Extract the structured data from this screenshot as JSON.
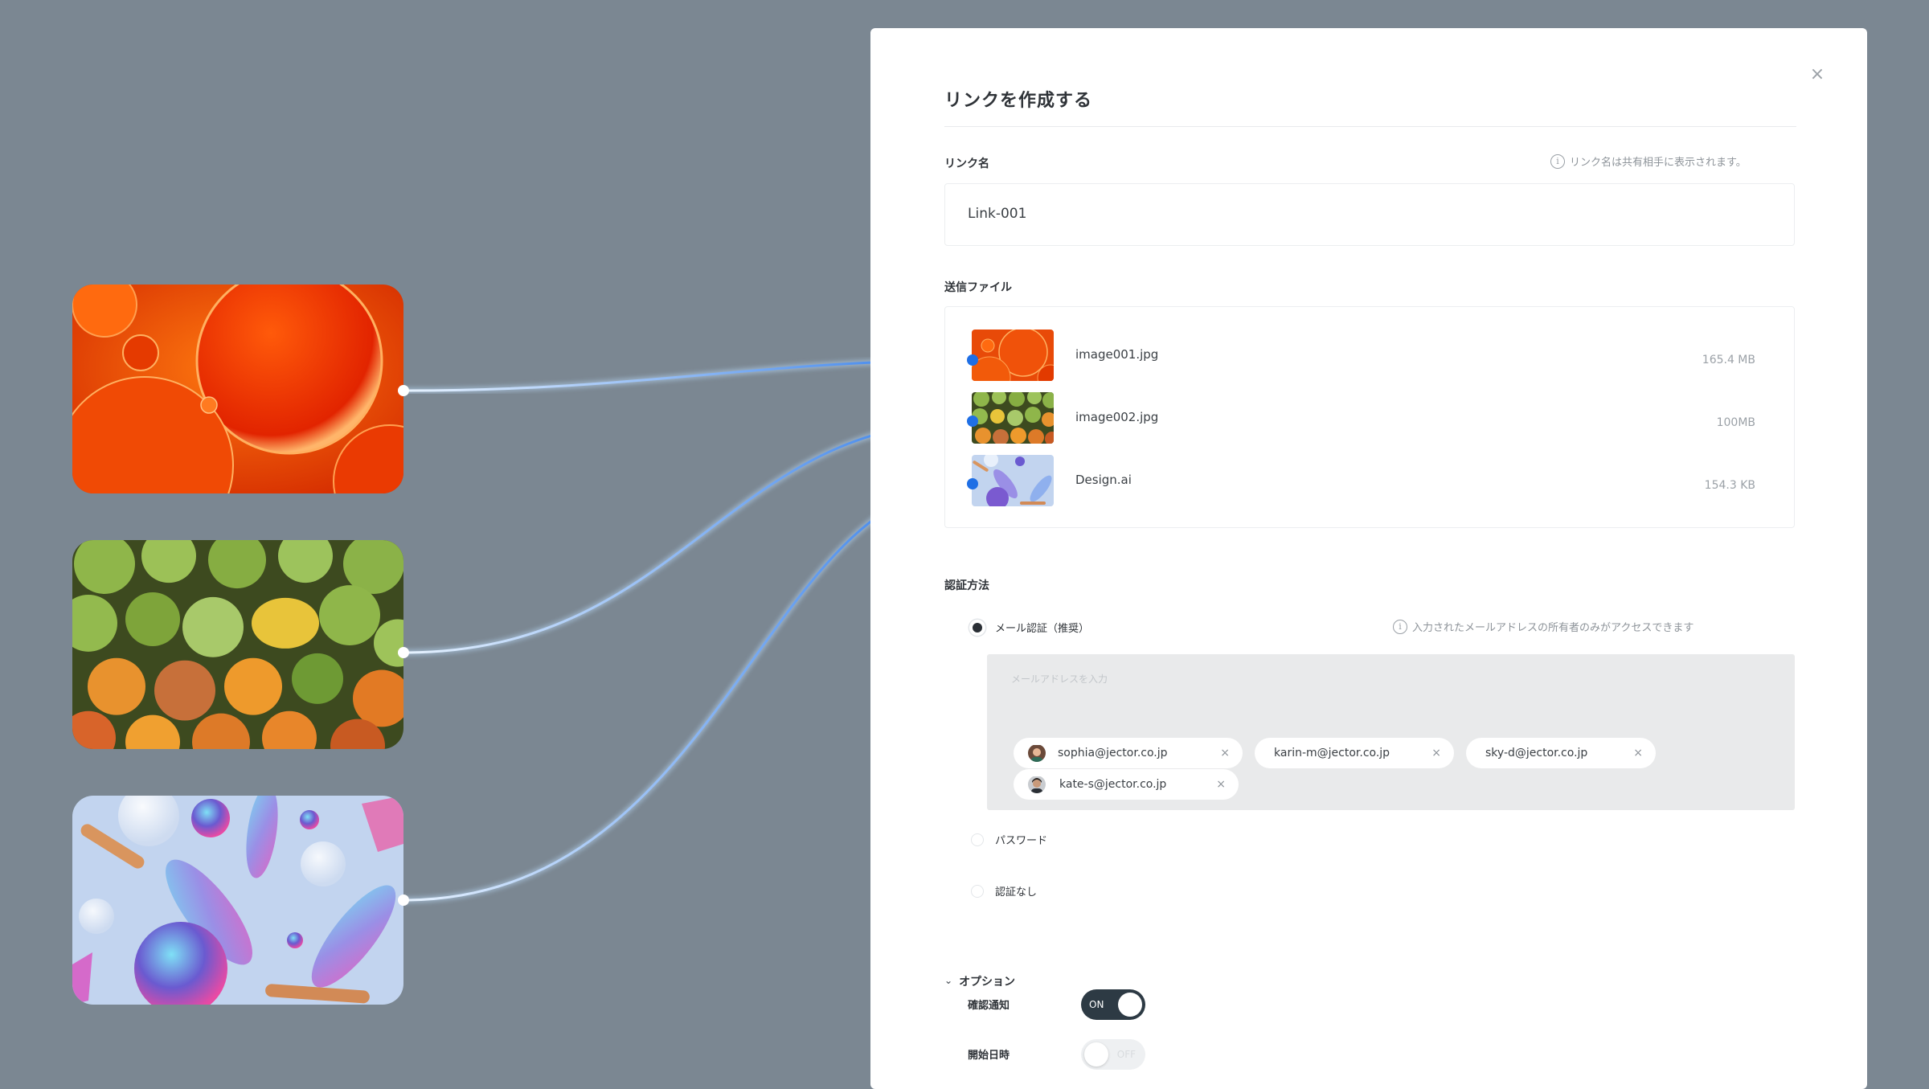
{
  "dialog": {
    "title": "リンクを作成する",
    "close_icon": "×"
  },
  "link_name": {
    "label": "リンク名",
    "hint": "リンク名は共有相手に表示されます。",
    "value": "Link-001"
  },
  "files": {
    "label": "送信ファイル",
    "items": [
      {
        "name": "image001.jpg",
        "size": "165.4 MB"
      },
      {
        "name": "image002.jpg",
        "size": "100MB"
      },
      {
        "name": "Design.ai",
        "size": "154.3 KB"
      }
    ]
  },
  "auth": {
    "label": "認証方法",
    "options": [
      {
        "label": "メール認証（推奨）",
        "selected": true
      },
      {
        "label": "パスワード",
        "selected": false
      },
      {
        "label": "認証なし",
        "selected": false
      }
    ],
    "email_hint": "入力されたメールアドレスの所有者のみがアクセスできます",
    "email_placeholder": "メールアドレスを入力",
    "emails": [
      {
        "address": "sophia@jector.co.jp",
        "has_avatar": true
      },
      {
        "address": "karin-m@jector.co.jp",
        "has_avatar": false
      },
      {
        "address": "sky-d@jector.co.jp",
        "has_avatar": false
      },
      {
        "address": "kate-s@jector.co.jp",
        "has_avatar": true
      }
    ],
    "chip_remove": "×"
  },
  "options": {
    "label": "オプション",
    "items": [
      {
        "label": "確認通知",
        "state": "ON",
        "on": true
      },
      {
        "label": "開始日時",
        "state": "OFF",
        "on": false
      }
    ]
  },
  "colors": {
    "background": "#7b8792",
    "connector": "#2f7bea",
    "toggle_on": "#2d3a44"
  }
}
